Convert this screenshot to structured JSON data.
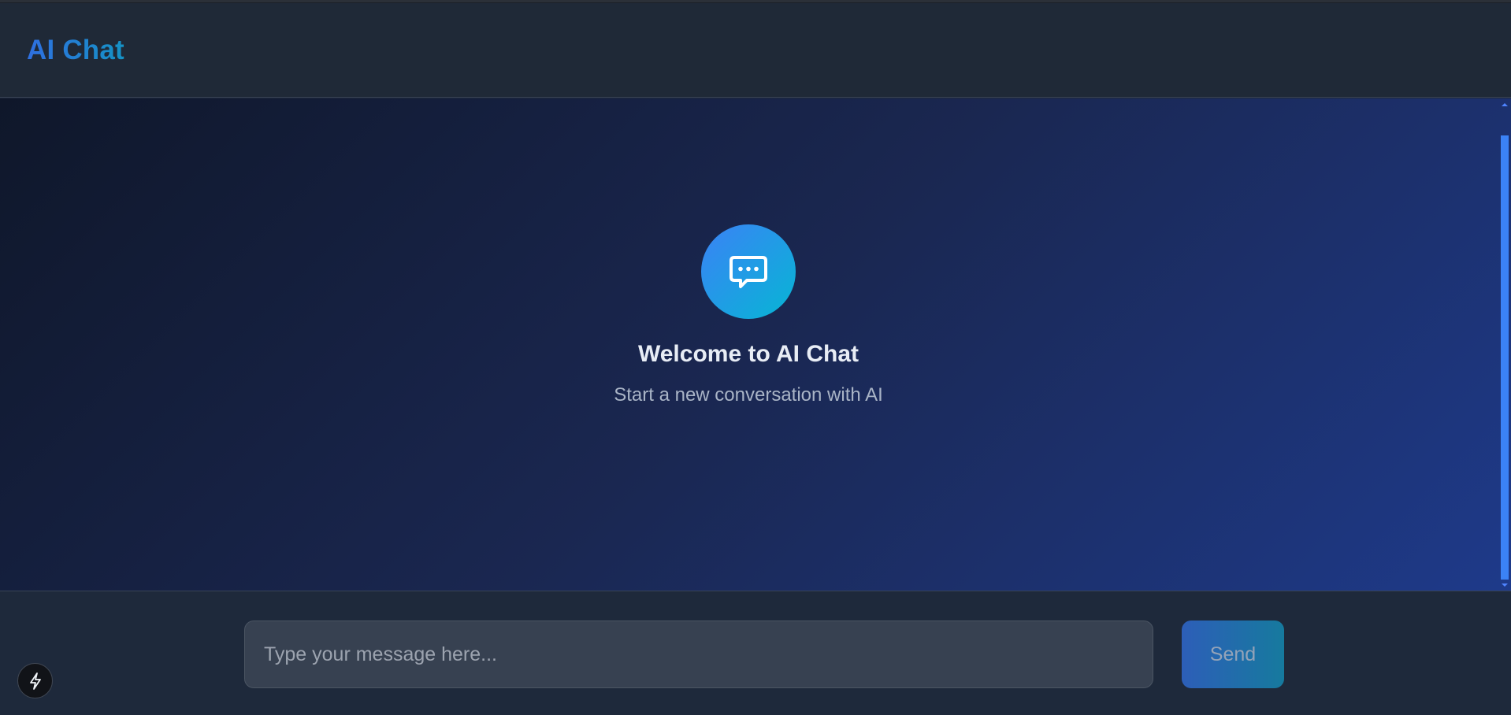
{
  "app": {
    "title": "AI Chat"
  },
  "welcome": {
    "icon": "chat-bubble-dots-icon",
    "title": "Welcome to AI Chat",
    "subtitle": "Start a new conversation with AI"
  },
  "composer": {
    "placeholder": "Type your message here...",
    "value": "",
    "send_label": "Send"
  },
  "floating": {
    "icon": "lightning-bolt-icon"
  },
  "colors": {
    "accent": "#3b82f6",
    "accent_secondary": "#06b6d4",
    "header_bg": "#1f2937",
    "input_bg": "#374151"
  }
}
